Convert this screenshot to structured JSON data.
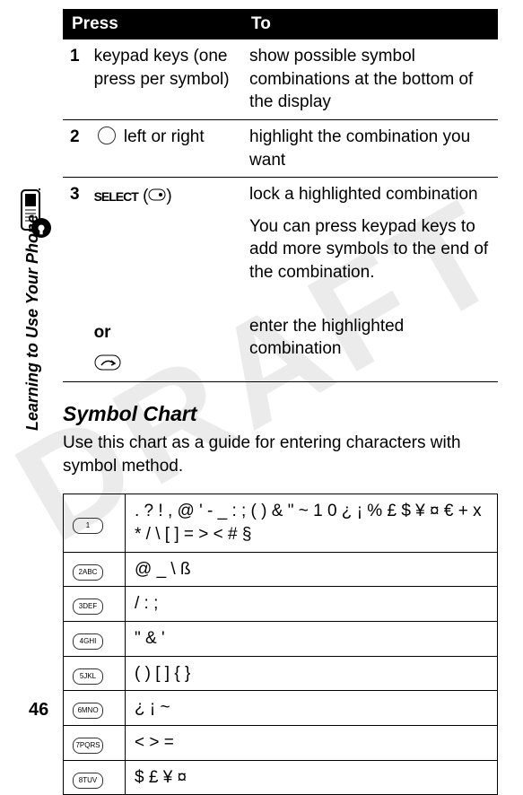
{
  "page_number": "46",
  "sidebar_label": "Learning to Use Your Phone",
  "watermark_text": "DRAFT",
  "press_table": {
    "headers": {
      "press": "Press",
      "to": "To"
    },
    "rows": [
      {
        "index": "1",
        "press": "keypad keys (one press per symbol)",
        "to": "show possible symbol combinations at the bottom of the display"
      },
      {
        "index": "2",
        "press_prefix": "",
        "press_suffix": "left or right",
        "icon": "nav-circle",
        "to": " highlight the combination you want"
      },
      {
        "index": "3",
        "select_label": "SELECT",
        "to_a": "lock a highlighted combination",
        "to_b": "You can press keypad keys to add more symbols to the end of the combination.",
        "or_label": "or",
        "to_c": "enter the highlighted combination"
      }
    ]
  },
  "section": {
    "title": "Symbol Chart",
    "desc": "Use this chart as a guide for entering characters with symbol method."
  },
  "symbol_chart": [
    {
      "keylabel": "1",
      "symbols": ". ? ! , @ ' - _ : ; ( ) & \" ~ 1 0 ¿ ¡ % £ $ ¥ ¤ € + x * / \\ [ ] = > < # §"
    },
    {
      "keylabel": "2ABC",
      "symbols": "@ _ \\    ß"
    },
    {
      "keylabel": "3DEF",
      "symbols": "/ : ;"
    },
    {
      "keylabel": "4GHI",
      "symbols": "\" & '"
    },
    {
      "keylabel": "5JKL",
      "symbols": "( ) [ ] { }"
    },
    {
      "keylabel": "6MNO",
      "symbols": "¿ ¡ ~"
    },
    {
      "keylabel": "7PQRS",
      "symbols": "< > ="
    },
    {
      "keylabel": "8TUV",
      "symbols": "$ £ ¥ ¤"
    }
  ]
}
